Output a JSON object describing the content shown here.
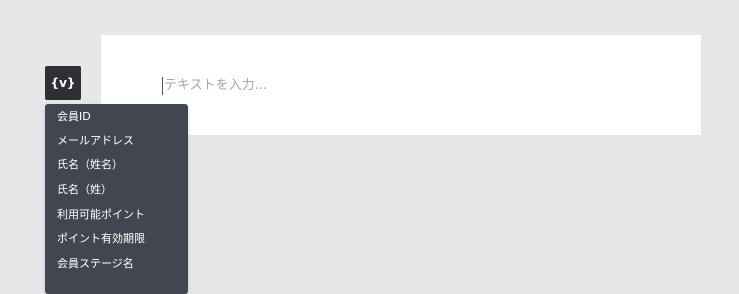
{
  "editor": {
    "placeholder": "テキストを入力..."
  },
  "variable_button": {
    "label": "{v}"
  },
  "variable_menu": {
    "items": [
      {
        "label": "会員ID"
      },
      {
        "label": "メールアドレス"
      },
      {
        "label": "氏名（姓名）"
      },
      {
        "label": "氏名（姓）"
      },
      {
        "label": "利用可能ポイント"
      },
      {
        "label": "ポイント有効期限"
      },
      {
        "label": "会員ステージ名"
      }
    ]
  }
}
